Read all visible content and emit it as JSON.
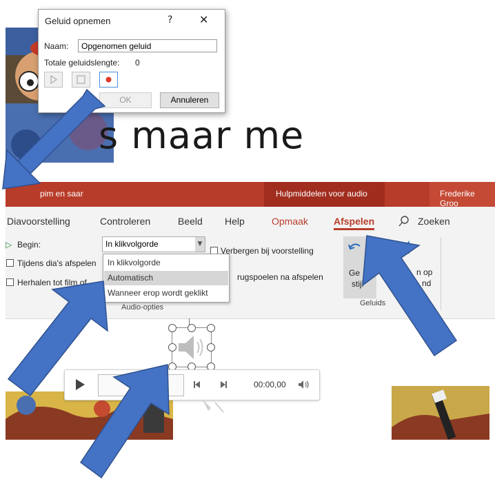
{
  "dialog": {
    "title": "Geluid opnemen",
    "help": "?",
    "close": "✕",
    "name_label": "Naam:",
    "name_value": "Opgenomen geluid",
    "length_label": "Totale geluidslengte:",
    "length_value": "0",
    "ok_label": "OK",
    "cancel_label": "Annuleren"
  },
  "slide": {
    "text": "s maar me"
  },
  "titlebar": {
    "document": "pim en saar",
    "tools": "Hulpmiddelen voor audio",
    "user": "Frederike Groo"
  },
  "tabs": [
    {
      "label": "Diavoorstelling"
    },
    {
      "label": "Controleren"
    },
    {
      "label": "Beeld"
    },
    {
      "label": "Help"
    },
    {
      "label": "Opmaak"
    },
    {
      "label": "Afspelen"
    },
    {
      "label": "Zoeken"
    }
  ],
  "ribbon": {
    "begin_label": "Begin:",
    "begin_value": "In klikvolgorde",
    "hide_label": "Verbergen bij voorstelling",
    "across_slides_label": "Tijdens dia's afspelen",
    "loop_label": "Herhalen tot film of",
    "rewind_label": "rugspoelen na afspelen",
    "group_audio_options": "Audio-opties",
    "style_btn_top": "Ge",
    "style_btn_bottom": "stijl",
    "bg_btn_top": "n op",
    "bg_btn_bottom": "nd",
    "group_styles": "Geluids"
  },
  "dropdown": {
    "options": [
      "In klikvolgorde",
      "Automatisch",
      "Wanneer erop wordt geklikt"
    ],
    "highlighted": "Automatisch"
  },
  "player": {
    "time": "00:00,00"
  },
  "colors": {
    "accent": "#b83c2a",
    "arrow": "#4472c4"
  }
}
